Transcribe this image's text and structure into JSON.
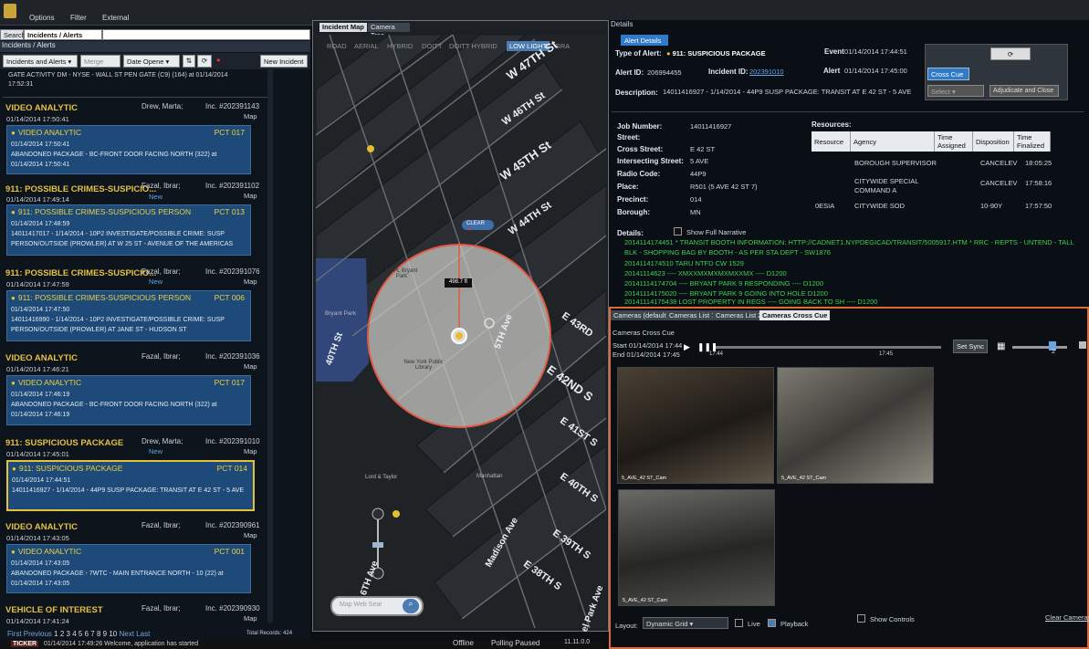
{
  "menubar": {
    "items": [
      "Options",
      "Filter",
      "External"
    ]
  },
  "left": {
    "tabs": [
      "Search",
      "Incidents / Alerts"
    ],
    "subheader": "Incidents / Alerts",
    "toolbar": {
      "dropdown1": "Incidents and Alerts",
      "merge": "Merge",
      "date": "Date Opene",
      "new_incident": "New Incident"
    },
    "top_line1": "GATE ACTIVITY DM - NYSE - WALL ST PEN GATE (C9) (164) at 01/14/2014",
    "top_line2": "17:52:31",
    "groups": [
      {
        "title": "VIDEO ANALYTIC",
        "name": "Drew, Marta;",
        "inc": "Inc. #202391143",
        "date": "01/14/2014 17:50:41",
        "new": "",
        "map": "Map",
        "card": {
          "title": "VIDEO ANALYTIC",
          "pct": "PCT 017",
          "lines": [
            "01/14/2014 17:50:41",
            "ABANDONED PACKAGE - BC-FRONT DOOR FACING NORTH (322) at",
            "01/14/2014 17:50:41"
          ]
        }
      },
      {
        "title": "911: POSSIBLE CRIMES-SUSPICIO...",
        "name": "Fazal, Ibrar;",
        "inc": "Inc. #202391102",
        "date": "01/14/2014 17:49:14",
        "new": "New",
        "map": "Map",
        "card": {
          "title": "911: POSSIBLE CRIMES-SUSPICIOUS PERSON",
          "pct": "PCT 013",
          "lines": [
            "01/14/2014 17:48:59",
            "14011417017 - 1/14/2014 - 10P2 INVESTIGATE/POSSIBLE CRIME: SUSP",
            "PERSON/OUTSIDE (PROWLER) AT W 25 ST - AVENUE OF THE AMERICAS"
          ]
        }
      },
      {
        "title": "911: POSSIBLE CRIMES-SUSPICIO...",
        "name": "Fazal, Ibrar;",
        "inc": "Inc. #202391076",
        "date": "01/14/2014 17:47:59",
        "new": "New",
        "map": "Map",
        "card": {
          "title": "911: POSSIBLE CRIMES-SUSPICIOUS PERSON",
          "pct": "PCT 006",
          "lines": [
            "01/14/2014 17:47:50",
            "14011416990 - 1/14/2014 - 10P2 INVESTIGATE/POSSIBLE CRIME: SUSP",
            "PERSON/OUTSIDE (PROWLER) AT JANE ST - HUDSON ST"
          ]
        }
      },
      {
        "title": "VIDEO ANALYTIC",
        "name": "Fazal, Ibrar;",
        "inc": "Inc. #202391036",
        "date": "01/14/2014 17:46:21",
        "new": "",
        "map": "Map",
        "card": {
          "title": "VIDEO ANALYTIC",
          "pct": "PCT 017",
          "lines": [
            "01/14/2014 17:46:19",
            "ABANDONED PACKAGE - BC-FRONT DOOR FACING NORTH (322) at",
            "01/14/2014 17:46:19"
          ]
        }
      },
      {
        "title": "911: SUSPICIOUS PACKAGE",
        "name": "Drew, Marta;",
        "inc": "Inc. #202391010",
        "date": "01/14/2014 17:45:01",
        "new": "New",
        "map": "Map",
        "card": {
          "title": "911: SUSPICIOUS PACKAGE",
          "pct": "PCT 014",
          "lines": [
            "01/14/2014 17:44:51",
            "14011416927 - 1/14/2014 - 44P9 SUSP PACKAGE: TRANSIT AT E 42 ST - 5 AVE"
          ]
        }
      },
      {
        "title": "VIDEO ANALYTIC",
        "name": "Fazal, Ibrar;",
        "inc": "Inc. #202390961",
        "date": "01/14/2014 17:43:05",
        "new": "",
        "map": "Map",
        "card": {
          "title": "VIDEO ANALYTIC",
          "pct": "PCT 001",
          "lines": [
            "01/14/2014 17:43:05",
            "ABANDONED PACKAGE - 7WTC - MAIN ENTRANCE NORTH - 10 (22) at",
            "01/14/2014 17:43:05"
          ]
        }
      },
      {
        "title": "VEHICLE OF INTEREST",
        "name": "Fazal, Ibrar;",
        "inc": "Inc. #202390930",
        "date": "01/14/2014 17:41:24",
        "new": "",
        "map": "Map"
      }
    ],
    "pager": {
      "first": "First",
      "previous": "Previous",
      "pages": [
        "1",
        "2",
        "3",
        "4",
        "5",
        "6",
        "7",
        "8",
        "9",
        "10"
      ],
      "next": "Next",
      "last": "Last",
      "records": "Total Records: 424"
    },
    "ticker": {
      "label": "TICKER",
      "text": "01/14/2014 17:49:26 Welcome, application has started"
    }
  },
  "map": {
    "tabs": [
      "Incident Map",
      "Camera Tree"
    ],
    "modes": [
      "ROAD",
      "AERIAL",
      "HYBRID",
      "DOITT",
      "DOITT HYBRID",
      "LOW LIGHT",
      "GRA"
    ],
    "selected_mode": "LOW LIGHT",
    "streets": [
      "W 47TH St",
      "W 46TH St",
      "W 45TH St",
      "W 44TH St",
      "E 43RD",
      "E 42ND S",
      "E 41ST S",
      "E 40TH S",
      "E 39TH S",
      "E 38TH S",
      "5TH Ave",
      "Madison Ave",
      "6TH Ave",
      "40TH St",
      "el Park Ave"
    ],
    "places": [
      "Bryant Park",
      "Lord & Taylor",
      "Manhattan",
      "New York Public Library",
      "NYPL Bryant Park"
    ],
    "radius": "498.7 ft",
    "clear": "CLEAR",
    "search_placeholder": "Map Web Sear",
    "status": {
      "offline": "Offline",
      "polling": "Polling Paused",
      "version": "11.11.0.0"
    }
  },
  "details": {
    "header": "Details",
    "tab": "Alert Details",
    "type_label": "Type of Alert:",
    "type_value": "911: SUSPICIOUS PACKAGE",
    "event_label": "Event",
    "event_value": "01/14/2014 17:44:51",
    "alert_id_label": "Alert ID:",
    "alert_id": "206994455",
    "incident_id_label": "Incident ID:",
    "incident_id": "202391010",
    "alert_label": "Alert",
    "alert_value": "01/14/2014 17:45:00",
    "desc_label": "Description:",
    "desc_value": "14011416927 - 1/14/2014 - 44P9 SUSP PACKAGE: TRANSIT AT E 42 ST - 5 AVE",
    "buttons": {
      "cross_cue": "Cross Cue",
      "select": "Select",
      "adjudicate": "Adjudicate and Close"
    },
    "fields": [
      {
        "label": "Job Number:",
        "value": "14011416927"
      },
      {
        "label": "Street:",
        "value": ""
      },
      {
        "label": "Cross Street:",
        "value": "E 42 ST"
      },
      {
        "label": "Intersecting Street:",
        "value": "5 AVE"
      },
      {
        "label": "Radio Code:",
        "value": "44P9"
      },
      {
        "label": "Place:",
        "value": "R501 (5 AVE 42 ST 7)"
      },
      {
        "label": "Precinct:",
        "value": "014"
      },
      {
        "label": "Borough:",
        "value": "MN"
      }
    ],
    "resources_label": "Resources:",
    "resources_headers": [
      "Resource",
      "Agency",
      "Time Assigned",
      "Disposition",
      "Time Finalized"
    ],
    "resources_rows": [
      [
        "",
        "BOROUGH SUPERVISOR",
        "",
        "CANCELEV",
        "18:05:25"
      ],
      [
        "",
        "CITYWIDE SPECIAL COMMAND A",
        "",
        "CANCELEV",
        "17:58:16"
      ],
      [
        "0ESIA",
        "CITYWIDE SOD",
        "",
        "10-90Y",
        "17:57:50"
      ]
    ],
    "details_label": "Details:",
    "show_narrative": "Show Full Narrative",
    "narrative": [
      "2014114174451 * TRANSIT BOOTH INFORMATION: HTTP://CADNET1.NYPDEGICAD/TRANSIT/5005917.HTM * RRC - REPTS - UNTEND - TALL",
      "BLK - SHOPPING BAG BY BOOTH - AS PER STA DEPT - SW1876",
      "2014114174510 TARU NTFD CW 1529",
      "20141114623 ---- XMXXMXMXMXMXXMX ---- D1200",
      "20141114174704 ---- BRYANT PARK 9 RESPONDING ---- D1200",
      "20141114175020 ---- BRYANT PARK 9 GOING INTO HOLE D1200",
      "20141114175438 LOST PROPERTY IN REGS ---- GOING BACK TO SH ---- D1200"
    ]
  },
  "cameras": {
    "tabs": [
      "Cameras (default)",
      "Cameras List 1",
      "Cameras List 2",
      "Cameras Cross Cue"
    ],
    "title": "Cameras Cross Cue",
    "start": "Start 01/14/2014 17:44",
    "end": "End 01/14/2014 17:45",
    "t1": "17:44",
    "t2": "17:45",
    "set_sync": "Set Sync",
    "zoom_value": "2",
    "captions": [
      "5_AVE_42 ST_Cam",
      "5_AVE_42 ST_Cam",
      "5_AVE_42 ST_Cam"
    ],
    "layout_label": "Layout:",
    "layout_value": "Dynamic Grid",
    "live": "Live",
    "playback": "Playback",
    "show_controls": "Show Controls",
    "clear_cameras": "Clear Cameras"
  }
}
